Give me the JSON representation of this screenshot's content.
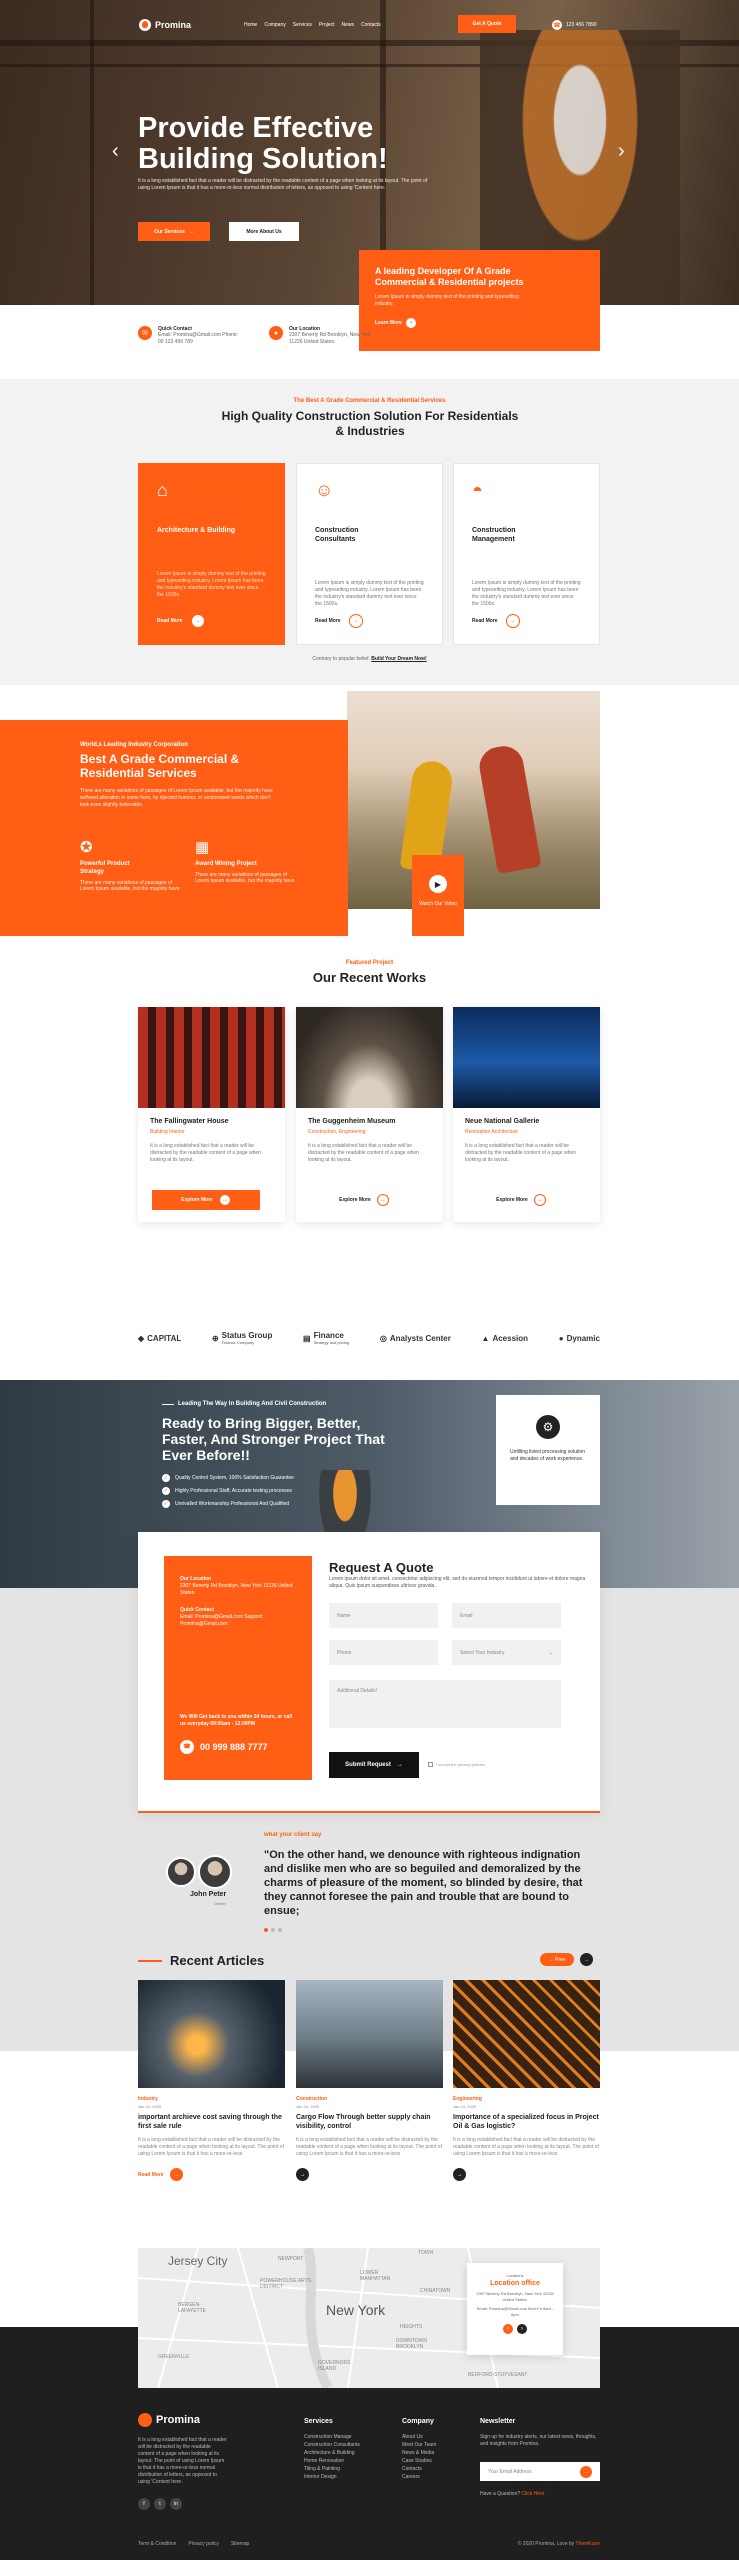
{
  "nav": {
    "logo": "Promina",
    "menu": [
      "Home",
      "Company",
      "Services",
      "Project",
      "News",
      "Contacts"
    ],
    "quote_btn": "Get A Quote",
    "phone": "123 456 7890"
  },
  "hero": {
    "title": "Provide Effective Building Solution!",
    "text": "It is a long established fact that a reader will be distracted by the readable content of a page when looking at its layout. The point of using Lorem Ipsum is that it has a more-or-less normal distribution of letters, as opposed to using 'Content here.",
    "btn_services": "Our Services",
    "btn_more": "More About Us",
    "lead_title": "A leading Developer Of A Grade Commercial & Residential projects",
    "lead_text": "Lorem Ipsum is simply dummy text of the printing and typesetting industry.",
    "lead_more": "Learn More"
  },
  "contact": [
    {
      "title": "Quick Contact",
      "value": "Email: Promina@Gmail.com Phone: 00 123 456 789"
    },
    {
      "title": "Our Location",
      "value": "2307 Beverly Rd Brooklyn, New York 11226 United States."
    }
  ],
  "services": {
    "sub": "The Best A Grade Commercial & Residential Services",
    "title": "High Quality Construction Solution For Residentials & Industries",
    "cards": [
      {
        "name": "Architecture & Building",
        "desc": "Lorem Ipsum is simply dummy text of the printing and typesetting industry. Lorem Ipsum has been the industry's standard dummy text ever since the 1500s.",
        "read": "Read More",
        "icon": "crane-icon"
      },
      {
        "name": "Construction Consultants",
        "desc": "Lorem Ipsum is simply dummy text of the printing and typesetting industry. Lorem Ipsum has been the industry's standard dummy text ever since the 1500s.",
        "read": "Read More",
        "icon": "worker-icon"
      },
      {
        "name": "Construction Management",
        "desc": "Lorem Ipsum is simply dummy text of the printing and typesetting industry. Lorem Ipsum has been the industry's standard dummy text ever since the 1500s.",
        "read": "Read More",
        "icon": "helmet-icon"
      }
    ],
    "note": "Contrary to popular belief.",
    "note_link": "Build Your Dream Now!"
  },
  "leading": {
    "sub": "World,s Leading Industry Corporation",
    "title": "Best A Grade Commercial & Residential Services",
    "text": "There are many variations of passages of Lorem Ipsum available, but the majority have suffered alteration in some form, by injected humour, or randomised words which don't look even slightly believable.",
    "features": [
      {
        "title": "Powerful Product Strategy",
        "desc": "There are many variations of passages of Lorem Ipsum available, but the majority have"
      },
      {
        "title": "Award Wining Project",
        "desc": "There are many variations of passages of Lorem Ipsum available, but the majority have"
      }
    ],
    "video_label": "Watch Our Video"
  },
  "projects": {
    "sub": "Featured Project",
    "title": "Our Recent Works",
    "items": [
      {
        "name": "The Fallingwater House",
        "cat": "Building Interior",
        "desc": "It is a long established fact that a reader will be distracted by the readable content of a page when looking at its layout.",
        "btn": "Explore More"
      },
      {
        "name": "The Guggenheim Museum",
        "cat": "Construction, Engineering",
        "desc": "It is a long established fact that a reader will be distracted by the readable content of a page when looking at its layout.",
        "btn": "Explore More"
      },
      {
        "name": "Neue National Gallerie",
        "cat": "Renovation Architecture",
        "desc": "It is a long established fact that a reader will be distracted by the readable content of a page when looking at its layout.",
        "btn": "Explore More"
      }
    ]
  },
  "partners": [
    {
      "name": "CAPITAL",
      "sub": ""
    },
    {
      "name": "Status Group",
      "sub": "Finance Company"
    },
    {
      "name": "Finance",
      "sub": "Strategy and pricing"
    },
    {
      "name": "Analysts Center",
      "sub": ""
    },
    {
      "name": "Acession",
      "sub": ""
    },
    {
      "name": "Dynamic",
      "sub": ""
    }
  ],
  "bigger": {
    "sub": "Leading The Way In Building And Civil Construction",
    "title": "Ready to Bring Bigger, Better, Faster, And Stronger Project That Ever Before!!",
    "list": [
      "Quality Control System, 100% Satisfaction Guarantee",
      "Highly Professional Staff, Accurate testing processes",
      "Unrivalled Workmanship Professional And Qualified"
    ],
    "card_text": "Unfilling listed processing solution and decades of work experience."
  },
  "quote": {
    "loc_title": "Our Location",
    "loc_value": "2307 Beverly Rd Brooklyn, New York 11226 United States.",
    "contact_title": "Quick Contact",
    "contact_value": "Email: Promina@Gmail.com Support: Promina@Gmail.com",
    "hours": "We Will Get back to you within 24 hours, or call us everyday 09:00am - 12:00PM",
    "phone": "00 999 888 7777",
    "title": "Request A Quote",
    "desc": "Lorem ipsum dolor sit amet, consectetur adipiscing elit, sed do eiusmod tempor incididunt ut labore et dolore magna aliqua. Quis ipsum suspendisse ultrices gravida.",
    "ph_name": "Name",
    "ph_email": "Email",
    "ph_phone": "Phone",
    "ph_industry": "Select Your Industry",
    "ph_details": "Additional Details!",
    "submit": "Submit Request",
    "consent": "I accept the privacy policies"
  },
  "testimonial": {
    "sub": "what your client say",
    "quote": "\"On the other hand, we denounce with righteous indignation and dislike men who are so beguiled and demoralized by the charms of pleasure of the moment, so blinded by desire, that they cannot foresee the pain and trouble that are bound to ensue;",
    "name": "John Peter",
    "role": "Owner"
  },
  "articles": {
    "title": "Recent Articles",
    "prev": "Prev",
    "next": "Next",
    "items": [
      {
        "cat": "Industry",
        "date": "Jan 24, 2020",
        "title": "important archieve cost saving through the first sale rule",
        "desc": "It is a long established fact that a reader will be distracted by the readable content of a page when looking at its layout. The point of using Lorem Ipsum is that it has a more-or-less",
        "more": "Read More"
      },
      {
        "cat": "Construction",
        "date": "Jan 24, 2020",
        "title": "Cargo Flow Through better supply chain visibility, control",
        "desc": "It is a long established fact that a reader will be distracted by the readable content of a page when looking at its layout. The point of using Lorem Ipsum is that it has a more-or-less",
        "more": ""
      },
      {
        "cat": "Engineering",
        "date": "Jan 24, 2020",
        "title": "Importance of a specialized focus in Project Oil & Gas logistic?",
        "desc": "It is a long established fact that a reader will be distracted by the readable content of a page when looking at its layout. The point of using Lorem Ipsum is that it has a more-or-less",
        "more": ""
      }
    ]
  },
  "map": {
    "labels": [
      "Jersey City",
      "NEWPORT",
      "POWERHOUSE ARTS DISTRICT",
      "LOWER MANHATTAN",
      "New York",
      "BERGEN-LAFAYETTE",
      "GREENVILLE",
      "GOVERNORS ISLAND",
      "DOWNTOWN BROOKLYN",
      "BEDFORD-STUYVESANT",
      "TOWN",
      "CHINATOWN",
      "HEIGHTS"
    ],
    "card_sub": "Locations",
    "card_title": "Location office",
    "card_addr": "2307 Beverly Rd Brooklyn, New York 11226 United States.",
    "card_mail": "Email: Promina@Gmail.com Mon-Fri 8am - 6pm"
  },
  "footer": {
    "logo": "Promina",
    "about": "It is a long established fact that a reader will be distracted by the readable content of a page when looking at its layout. The point of using Lorem Ipsum is that it has a more-or-less normal distribution of letters, as opposed to using 'Content here.",
    "services_title": "Services",
    "services": [
      "Construction Manage",
      "Construction Consultants",
      "Architecture & Building",
      "Home Renovation",
      "Tiling & Painting",
      "Interior Design"
    ],
    "company_title": "Company",
    "company": [
      "About Us",
      "Meet Our Team",
      "News & Media",
      "Case Studies",
      "Contacts",
      "Careers"
    ],
    "newsletter_title": "Newsletter",
    "newsletter_text": "Sign up for industry alerts, our latest news, thoughts, and insights from Promina.",
    "email_ph": "Your Email Address",
    "help": "Have a Question?",
    "help_link": "Click Here",
    "bottom_links": [
      "Term & Condition",
      "Privacy policy",
      "Sitemap"
    ],
    "copyright": "© 2020 Promina, Love by",
    "copyright_brand": "ThemKuon"
  }
}
